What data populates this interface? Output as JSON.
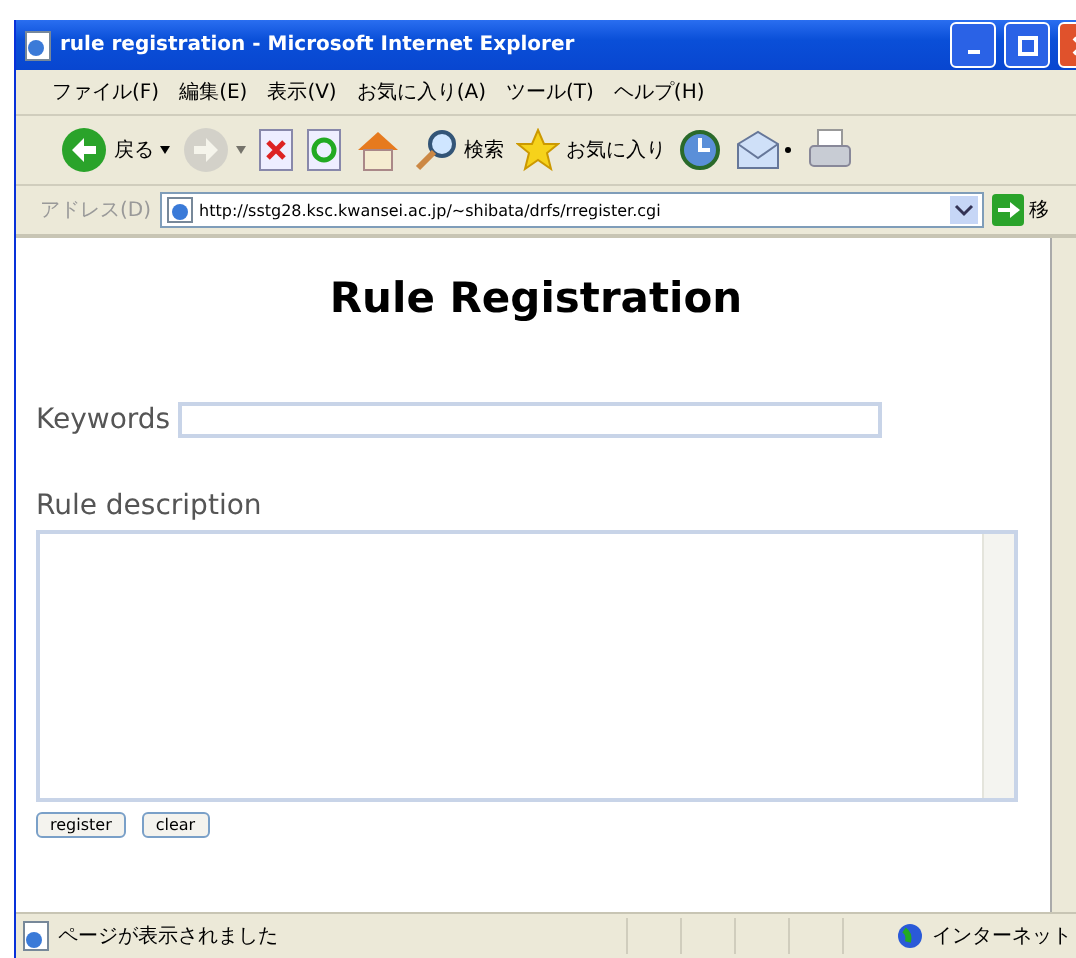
{
  "window": {
    "title": "rule registration - Microsoft Internet Explorer"
  },
  "menu": [
    "ファイル(F)",
    "編集(E)",
    "表示(V)",
    "お気に入り(A)",
    "ツール(T)",
    "ヘルプ(H)"
  ],
  "toolbar": [
    {
      "kind": "back",
      "label": "戻る",
      "disabled": false
    },
    {
      "kind": "forward",
      "disabled": true
    },
    {
      "kind": "stop",
      "disabled": false
    },
    {
      "kind": "refresh",
      "disabled": false
    },
    {
      "kind": "home",
      "disabled": false
    },
    {
      "kind": "search",
      "label": "検索",
      "disabled": false
    },
    {
      "kind": "favorites",
      "label": "お気に入り",
      "disabled": false
    },
    {
      "kind": "history",
      "disabled": false
    },
    {
      "kind": "mail",
      "disabled": false
    },
    {
      "kind": "print",
      "disabled": false
    }
  ],
  "address": {
    "label": "アドレス(D)",
    "url": "http://sstg28.ksc.kwansei.ac.jp/~shibata/drfs/rregister.cgi",
    "go": "移"
  },
  "page": {
    "heading": "Rule Registration",
    "keywords_label": "Keywords",
    "description_label": "Rule description",
    "buttons": [
      "register",
      "clear"
    ]
  },
  "status_bar": {
    "text": "ページが表示されました",
    "zone": "インターネット"
  }
}
